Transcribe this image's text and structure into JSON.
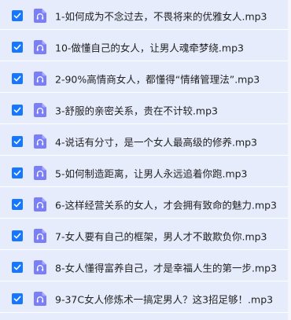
{
  "colors": {
    "row_background": "#e6ecfb",
    "row_divider": "#ffffff",
    "checkbox_fill": "#1677ff",
    "file_icon_fill": "#7b7ff7",
    "text": "#222222"
  },
  "files": [
    {
      "name": "1-如何成为不念过去，不畏将来的优雅女人.mp3",
      "checked": true,
      "icon": "audio-file-icon"
    },
    {
      "name": "10-做懂自己的女人，让男人魂牵梦绕.mp3",
      "checked": true,
      "icon": "audio-file-icon"
    },
    {
      "name": "2-90%高情商女人，都懂得“情绪管理法”.mp3",
      "checked": true,
      "icon": "audio-file-icon"
    },
    {
      "name": "3-舒服的亲密关系，贵在不计较.mp3",
      "checked": true,
      "icon": "audio-file-icon"
    },
    {
      "name": "4-说话有分寸，是一个女人最高级的修养.mp3",
      "checked": true,
      "icon": "audio-file-icon"
    },
    {
      "name": "5-如何制造距离，让男人永远追着你跑.mp3",
      "checked": true,
      "icon": "audio-file-icon"
    },
    {
      "name": "6-这样经营关系的女人，才会拥有致命的魅力.mp3",
      "checked": true,
      "icon": "audio-file-icon"
    },
    {
      "name": "7-女人要有自己的框架，男人才不敢欺负你.mp3",
      "checked": true,
      "icon": "audio-file-icon"
    },
    {
      "name": "8-女人懂得富养自己，才是幸福人生的第一步.mp3",
      "checked": true,
      "icon": "audio-file-icon"
    },
    {
      "name": "9-37C女人修炼术一搞定男人？这3招足够！.mp3",
      "checked": true,
      "icon": "audio-file-icon"
    }
  ]
}
